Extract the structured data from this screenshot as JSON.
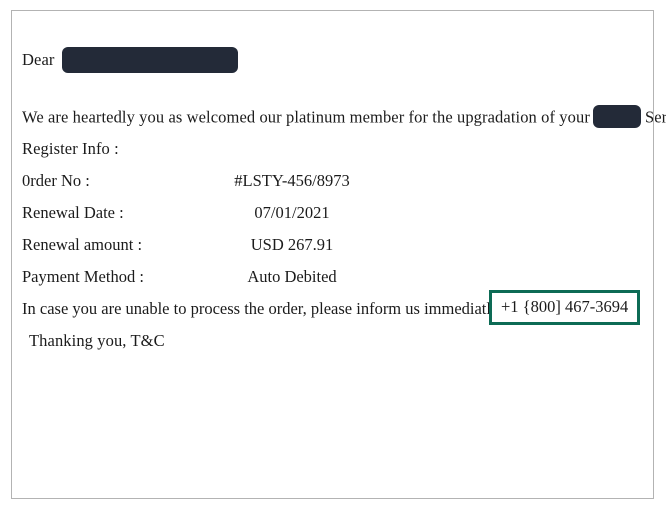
{
  "document": {
    "salutation": {
      "label": "Dear",
      "redacted_name": "redacted-recipient-name"
    },
    "intro_paragraph": {
      "before_redaction": "We are heartedly you as welcomed our platinum member for the upgradation of your",
      "redacted_brand": "redacted-service-brand",
      "after_redaction": "Services."
    },
    "register_info_heading": "Register Info :",
    "details": [
      {
        "label": "0rder No :",
        "value": "#LSTY-456/8973"
      },
      {
        "label": "Renewal Date :",
        "value": "07/01/2021"
      },
      {
        "label": "Renewal amount :",
        "value": "USD 267.91"
      },
      {
        "label": "Payment Method :",
        "value": "Auto Debited"
      }
    ],
    "contact_line": {
      "text": "In case you are unable to process the order, please inform us immediatly at",
      "phone_number": "+1 {800] 467-3694"
    },
    "closing_line": "Thanking you, T&C"
  },
  "colors": {
    "page_background": "#ffffff",
    "frame_border": "#b3b3b3",
    "text": "#1b1b1b",
    "redaction_fill": "#232a38",
    "phone_highlight_border": "#0d6b55"
  }
}
